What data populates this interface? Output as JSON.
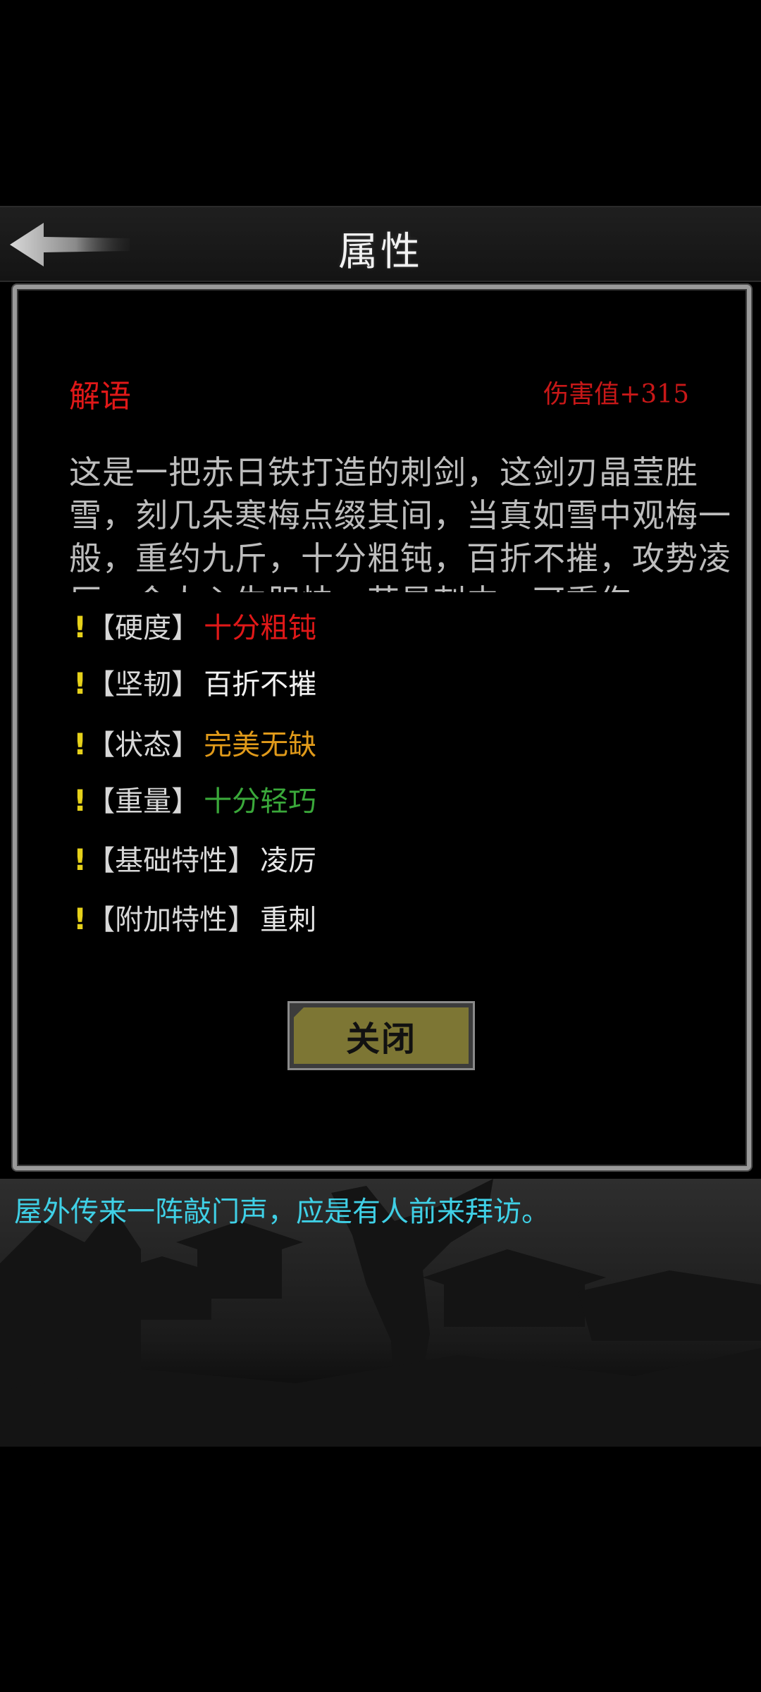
{
  "header": {
    "title": "属性",
    "back_icon": "back-arrow-icon"
  },
  "dialog": {
    "section_label": "解语",
    "damage": "伤害值+315",
    "description": "这是一把赤日铁打造的刺剑，这剑刃晶莹胜雪，刻几朵寒梅点缀其间，当真如雪中观梅一般，重约九斤，十分粗钝，百折不摧，攻势凌厉，令人心生胆怯，若是刺中，可重伤",
    "attributes": [
      {
        "mark": "!",
        "key": "【硬度】",
        "value": "十分粗钝",
        "color": "#e01818"
      },
      {
        "mark": "!",
        "key": "【坚韧】",
        "value": "百折不摧",
        "color": "#f2f2f2"
      },
      {
        "mark": "!",
        "key": "【状态】",
        "value": "完美无缺",
        "color": "#e09a1a"
      },
      {
        "mark": "!",
        "key": "【重量】",
        "value": "十分轻巧",
        "color": "#3aa83a"
      },
      {
        "mark": "!",
        "key": "【基础特性】",
        "value": "凌厉",
        "color": "#e6e6e6"
      },
      {
        "mark": "!",
        "key": "【附加特性】",
        "value": "重刺",
        "color": "#e6e6e6"
      }
    ],
    "close_label": "关闭"
  },
  "message": "屋外传来一阵敲门声，应是有人前来拜访。",
  "colors": {
    "accent_red": "#e01818",
    "mark_yellow": "#e6d11a",
    "message_cyan": "#3fd0e6",
    "button_olive": "#7d7634"
  }
}
